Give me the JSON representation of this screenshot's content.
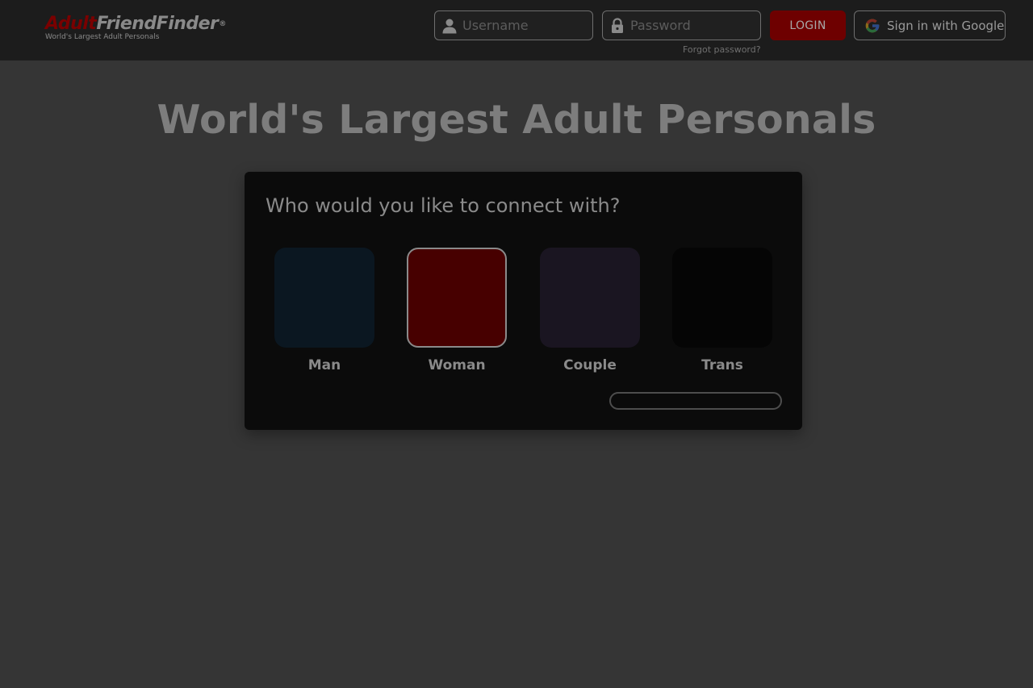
{
  "header": {
    "logo": {
      "part_red": "Adult",
      "part_gray": "FriendFinder",
      "trademark": "®",
      "tagline": "World's Largest Adult Personals"
    },
    "username": {
      "placeholder": "Username",
      "value": ""
    },
    "password": {
      "placeholder": "Password",
      "value": ""
    },
    "forgot_password": "Forgot password?",
    "login_label": "LOGIN",
    "google_label": "Sign in with Google"
  },
  "hero": {
    "title": "World's Largest Adult Personals"
  },
  "connect": {
    "question": "Who would you like to connect with?",
    "options": [
      {
        "label": "Man",
        "selected": false
      },
      {
        "label": "Woman",
        "selected": true
      },
      {
        "label": "Couple",
        "selected": false
      },
      {
        "label": "Trans",
        "selected": false
      }
    ],
    "continue_label": ""
  },
  "colors": {
    "brand_red": "#6e0000",
    "selected_tile": "#470000",
    "background": "#353535",
    "header": "#1c1c1c",
    "card": "#0b0b0b"
  },
  "icons": {
    "username": "user-icon",
    "password": "lock-icon",
    "google": "google-icon"
  }
}
